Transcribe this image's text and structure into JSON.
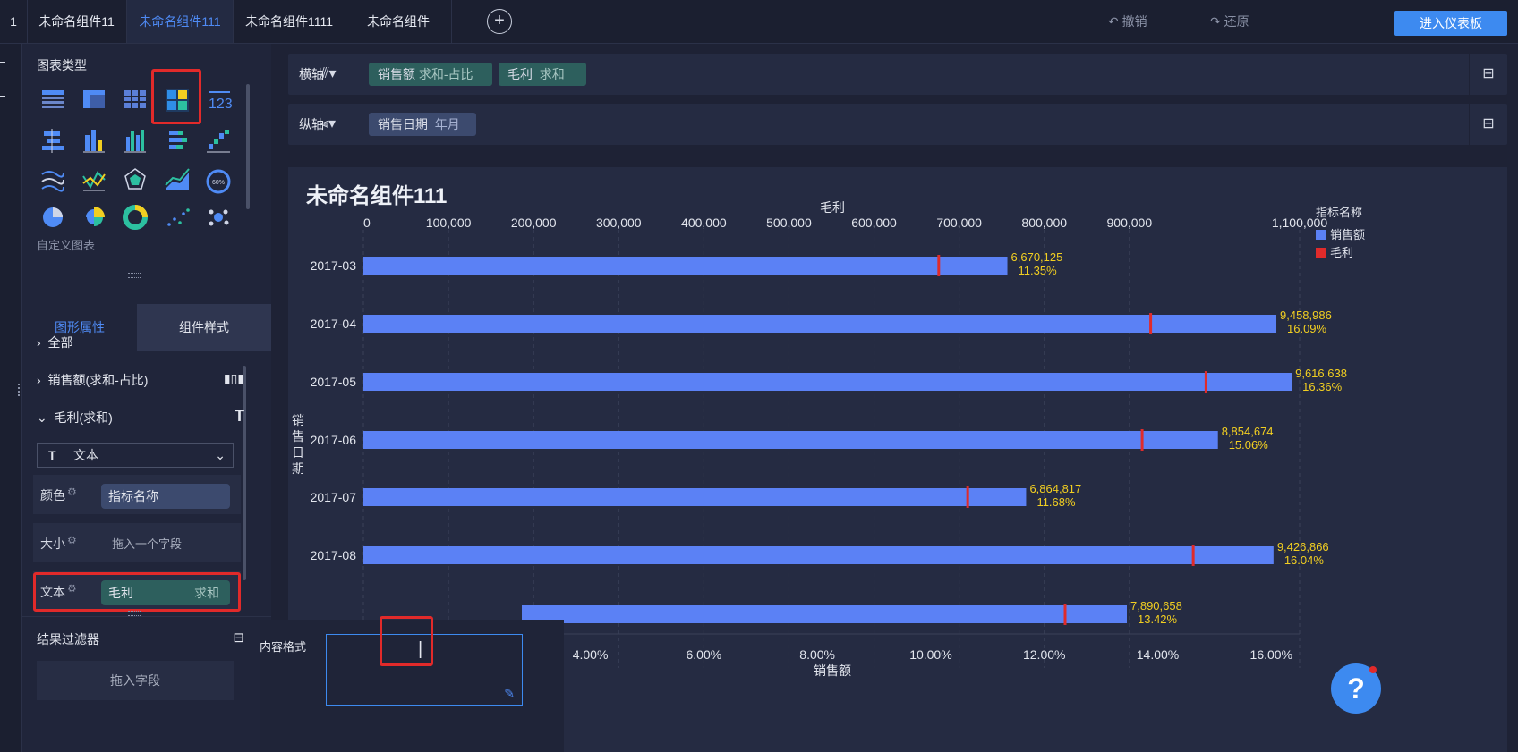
{
  "tabs": [
    {
      "label": "1"
    },
    {
      "label": "未命名组件11"
    },
    {
      "label": "未命名组件111"
    },
    {
      "label": "未命名组件1111"
    },
    {
      "label": "未命名组件"
    }
  ],
  "toolbar": {
    "undo": "撤销",
    "redo": "还原",
    "enter_dashboard": "进入仪表板"
  },
  "left": {
    "chart_type_title": "图表类型",
    "custom_chart": "自定义图表",
    "tab_shape_props": "图形属性",
    "tab_component_style": "组件样式",
    "tree": {
      "all": "全部",
      "sales": "销售额(求和-占比)",
      "profit": "毛利(求和)"
    },
    "mark_type": "文本",
    "color_label": "颜色",
    "color_field": "指标名称",
    "size_label": "大小",
    "size_placeholder": "拖入一个字段",
    "text_label": "文本",
    "text_field": "毛利",
    "text_field_agg": "求和",
    "filter_title": "结果过滤器",
    "filter_placeholder": "拖入字段"
  },
  "xaxis_bar": {
    "label": "横轴",
    "pills": [
      {
        "name": "销售额",
        "agg": "求和-占比"
      },
      {
        "name": "毛利",
        "agg": "求和"
      }
    ]
  },
  "yaxis_bar": {
    "label": "纵轴",
    "pills": [
      {
        "name": "销售日期",
        "agg": "年月"
      }
    ]
  },
  "popup": {
    "label": "内容格式"
  },
  "help": "?",
  "colors": {
    "accent": "#3d8af0",
    "bar": "#5b81f5",
    "marker": "#e02b2b",
    "label": "#f2cf21",
    "highlight": "#e12a2a"
  },
  "chart_data": {
    "type": "bar",
    "title": "未命名组件111",
    "top_axis_label": "毛利",
    "top_ticks": [
      "0",
      "100,000",
      "200,000",
      "300,000",
      "400,000",
      "500,000",
      "600,000",
      "700,000",
      "800,000",
      "900,000",
      "1,100,000"
    ],
    "bottom_axis_label": "销售额",
    "bottom_ticks": [
      "4.00%",
      "6.00%",
      "8.00%",
      "10.00%",
      "12.00%",
      "14.00%",
      "16.00%"
    ],
    "ylabel": "销售日期",
    "legend_title": "指标名称",
    "legend": [
      {
        "name": "销售额",
        "color": "#5b81f5"
      },
      {
        "name": "毛利",
        "color": "#e02b2b"
      }
    ],
    "categories": [
      "2017-03",
      "2017-04",
      "2017-05",
      "2017-06",
      "2017-07",
      "2017-08",
      "2017-09"
    ],
    "sales_share": [
      11.35,
      16.09,
      16.36,
      15.06,
      11.68,
      16.04,
      13.42
    ],
    "sales_share_labels": [
      "11.35%",
      "16.09%",
      "16.36%",
      "15.06%",
      "11.68%",
      "16.04%",
      "13.42%"
    ],
    "profit": [
      676000,
      925000,
      990000,
      915000,
      710000,
      975000,
      830000
    ],
    "value_labels": [
      "6,670,125",
      "9,458,986",
      "9,616,638",
      "8,854,674",
      "6,864,817",
      "9,426,866",
      "7,890,658"
    ]
  }
}
